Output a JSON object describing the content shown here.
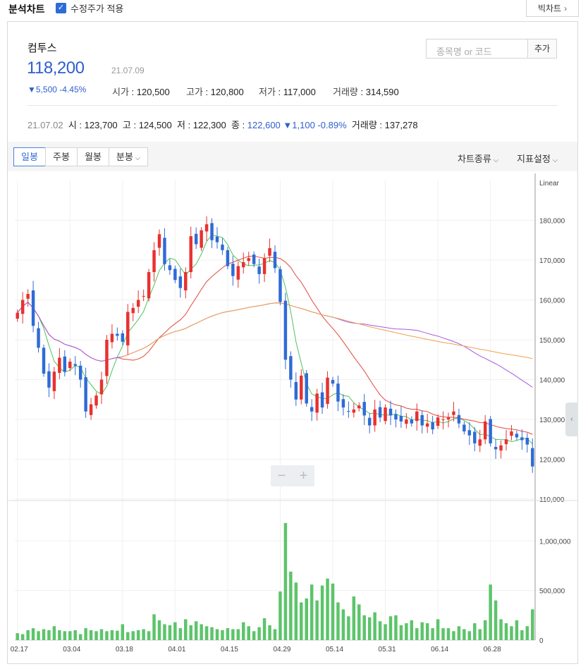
{
  "topbar": {
    "title": "분석차트",
    "adjusted_label": "수정주가 적용",
    "adjusted_checked": true,
    "big_chart": "빅차트"
  },
  "stock": {
    "name": "컴투스",
    "price": "118,200",
    "date": "21.07.09",
    "change": "5,500",
    "change_pct": "-4.45%",
    "open_label": "시가",
    "open": "120,500",
    "high_label": "고가",
    "high": "120,800",
    "low_label": "저가",
    "low": "117,000",
    "volume_label": "거래량",
    "volume": "314,590"
  },
  "search": {
    "placeholder": "종목명 or 코드",
    "add_label": "추가"
  },
  "prev": {
    "date": "21.07.02",
    "o_label": "시",
    "o": "123,700",
    "h_label": "고",
    "h": "124,500",
    "l_label": "저",
    "l": "122,300",
    "c_label": "종",
    "c": "122,600",
    "change": "1,100",
    "change_pct": "-0.89%",
    "v_label": "거래량",
    "v": "137,278"
  },
  "toolbar": {
    "tabs": [
      "일봉",
      "주봉",
      "월봉",
      "분봉"
    ],
    "chart_type": "차트종류",
    "indicator": "지표설정"
  },
  "chart_data": {
    "type": "candlestick",
    "scale_label": "Linear",
    "price_ticks": [
      180000,
      170000,
      160000,
      150000,
      140000,
      130000,
      120000,
      110000
    ],
    "price_tick_labels": [
      "180,000",
      "170,000",
      "160,000",
      "150,000",
      "140,000",
      "130,000",
      "120,000",
      "110,000"
    ],
    "volume_ticks": [
      1000000,
      500000,
      0
    ],
    "volume_tick_labels": [
      "1,000,000",
      "500,000",
      "0"
    ],
    "x_tick_labels": [
      "02.17",
      "03.04",
      "03.18",
      "04.01",
      "04.15",
      "04.29",
      "05.14",
      "05.31",
      "06.14",
      "06.28"
    ],
    "x_tick_index": [
      0,
      10,
      20,
      30,
      40,
      50,
      60,
      70,
      80,
      90
    ],
    "up_color": "#e8312f",
    "down_color": "#2f6bd6",
    "volume_color": "#5cc46a",
    "ma_colors": [
      "#4cc45c",
      "#e04a3a",
      "#a35ce0",
      "#f0a04a"
    ],
    "closes": [
      156800,
      160000,
      161500,
      153500,
      148000,
      141500,
      138000,
      142000,
      145500,
      142000,
      144500,
      143500,
      140000,
      132000,
      133800,
      136000,
      140000,
      150000,
      151500,
      151000,
      149500,
      157000,
      158000,
      160000,
      161000,
      167000,
      172500,
      176500,
      169000,
      167500,
      165000,
      163000,
      167000,
      176000,
      174000,
      177500,
      179000,
      175000,
      174500,
      172500,
      168500,
      166000,
      168500,
      169500,
      170500,
      169000,
      166500,
      170500,
      173000,
      168000,
      159500,
      145000,
      140000,
      135000,
      141000,
      134000,
      132000,
      136500,
      133000,
      140500,
      139000,
      134500,
      133000,
      132000,
      132500,
      133500,
      131000,
      128500,
      132500,
      130500,
      133000,
      131000,
      130000,
      129500,
      130000,
      129000,
      132000,
      128500,
      129000,
      127500,
      130500,
      130000,
      130500,
      132000,
      129000,
      127000,
      126000,
      124000,
      125000,
      129500,
      124000,
      122500,
      123500,
      125000,
      127000,
      125500,
      124800,
      123700,
      118200
    ],
    "volume": [
      70000,
      60000,
      100000,
      120000,
      90000,
      110000,
      100000,
      140000,
      100000,
      90000,
      90000,
      100000,
      60000,
      120000,
      100000,
      90000,
      110000,
      90000,
      100000,
      95000,
      160000,
      80000,
      90000,
      100000,
      110000,
      90000,
      260000,
      200000,
      160000,
      150000,
      180000,
      120000,
      210000,
      150000,
      190000,
      160000,
      140000,
      130000,
      110000,
      100000,
      120000,
      110000,
      110000,
      180000,
      140000,
      90000,
      130000,
      220000,
      150000,
      110000,
      490000,
      1180000,
      690000,
      580000,
      380000,
      420000,
      560000,
      400000,
      550000,
      620000,
      570000,
      380000,
      310000,
      240000,
      440000,
      360000,
      250000,
      230000,
      280000,
      190000,
      160000,
      240000,
      250000,
      150000,
      170000,
      200000,
      120000,
      180000,
      170000,
      120000,
      210000,
      120000,
      120000,
      90000,
      140000,
      110000,
      90000,
      170000,
      110000,
      200000,
      560000,
      400000,
      210000,
      170000,
      140000,
      200000,
      100000,
      140000,
      310000
    ]
  }
}
